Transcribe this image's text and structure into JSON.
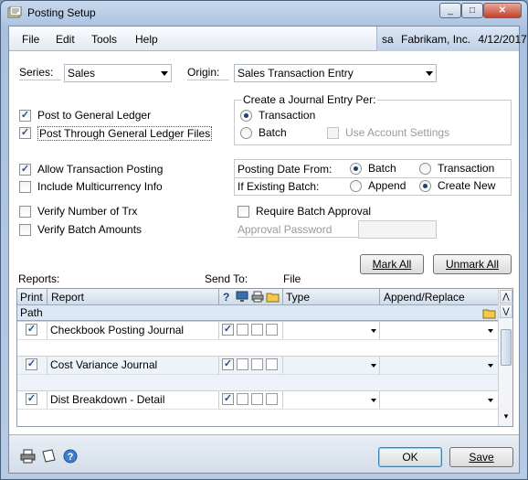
{
  "window": {
    "title": "Posting Setup",
    "min": "_",
    "max": "□",
    "close": "✕"
  },
  "menu": {
    "file": "File",
    "edit": "Edit",
    "tools": "Tools",
    "help": "Help"
  },
  "userinfo": {
    "user": "sa",
    "company": "Fabrikam, Inc.",
    "date": "4/12/2017"
  },
  "series": {
    "label": "Series:",
    "value": "Sales"
  },
  "origin": {
    "label": "Origin:",
    "value": "Sales Transaction Entry"
  },
  "options": {
    "post_gl": "Post to General Ledger",
    "post_through_gl": "Post Through General Ledger Files",
    "allow_trx_posting": "Allow Transaction Posting",
    "include_multicurrency": "Include Multicurrency Info",
    "verify_trx": "Verify Number of Trx",
    "verify_batch": "Verify Batch Amounts"
  },
  "journal_entry": {
    "title": "Create a Journal Entry Per:",
    "transaction": "Transaction",
    "batch": "Batch",
    "use_account_settings": "Use Account Settings"
  },
  "posting_date": {
    "label": "Posting Date From:",
    "batch": "Batch",
    "transaction": "Transaction"
  },
  "existing_batch": {
    "label": "If Existing Batch:",
    "append": "Append",
    "create_new": "Create New"
  },
  "approval": {
    "require": "Require Batch Approval",
    "password_label": "Approval Password"
  },
  "buttons": {
    "mark_all": "Mark All",
    "unmark_all": "Unmark All",
    "ok": "OK",
    "save": "Save"
  },
  "reports_label": "Reports:",
  "send_to_label": "Send To:",
  "file_label": "File",
  "grid": {
    "headers": {
      "print": "Print",
      "report": "Report",
      "help": "?",
      "type": "Type",
      "append": "Append/Replace",
      "path": "Path"
    },
    "rows": [
      {
        "report": "Checkbook Posting Journal",
        "print": "✓",
        "screen": "✓"
      },
      {
        "report": "Cost Variance Journal",
        "print": "✓",
        "screen": "✓"
      },
      {
        "report": "Dist Breakdown - Detail",
        "print": "✓",
        "screen": "✓"
      }
    ]
  },
  "checked": "✓"
}
